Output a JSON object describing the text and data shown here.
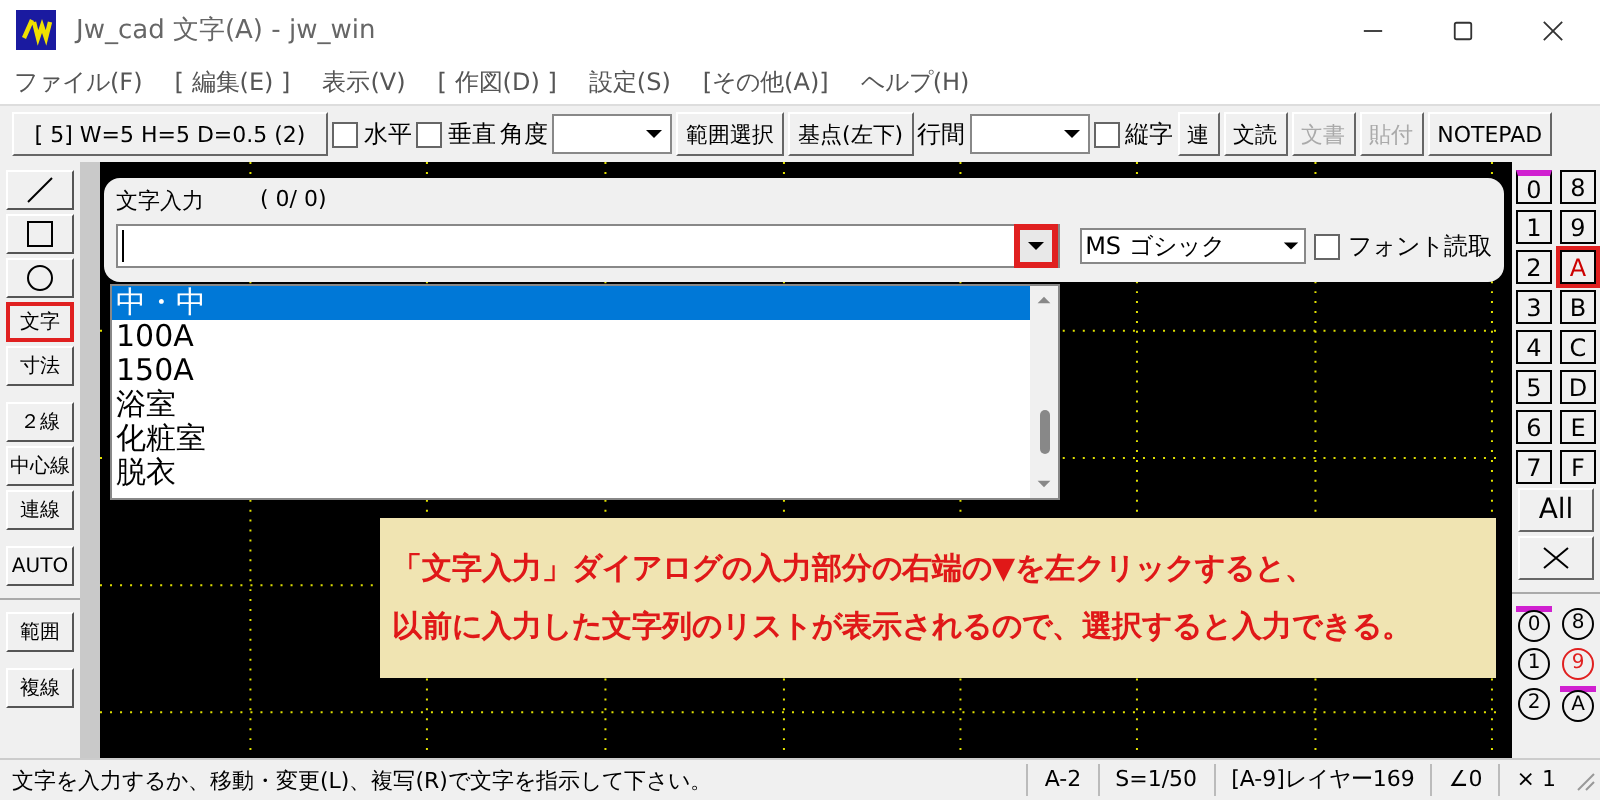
{
  "window": {
    "title": "Jw_cad 文字(A) - jw_win"
  },
  "menu": [
    "ファイル(F)",
    "[ 編集(E) ]",
    "表示(V)",
    "[ 作図(D) ]",
    "設定(S)",
    "[その他(A)]",
    "ヘルプ(H)"
  ],
  "toolbar": [
    {
      "kind": "button",
      "label": "[ 5]  W=5  H=5  D=0.5 (2)",
      "disabled": false
    },
    {
      "kind": "checkbox",
      "label": "水平",
      "checked": false
    },
    {
      "kind": "checkbox",
      "label": "垂直",
      "checked": false
    },
    {
      "kind": "label",
      "label": "角度"
    },
    {
      "kind": "combo"
    },
    {
      "kind": "button",
      "label": "範囲選択",
      "disabled": false
    },
    {
      "kind": "button",
      "label": "基点(左下)",
      "disabled": false
    },
    {
      "kind": "label",
      "label": "行間"
    },
    {
      "kind": "combo"
    },
    {
      "kind": "checkbox",
      "label": "縦字",
      "checked": false
    },
    {
      "kind": "button",
      "label": "連",
      "disabled": false
    },
    {
      "kind": "button",
      "label": "文読",
      "disabled": false
    },
    {
      "kind": "button",
      "label": "文書",
      "disabled": true
    },
    {
      "kind": "button",
      "label": "貼付",
      "disabled": true
    },
    {
      "kind": "button",
      "label": "NOTEPAD",
      "disabled": false
    }
  ],
  "tools": [
    {
      "kind": "line",
      "highlighted": false
    },
    {
      "kind": "rect",
      "highlighted": false
    },
    {
      "kind": "circle",
      "highlighted": false
    },
    {
      "kind": "text",
      "label": "文字",
      "highlighted": true
    },
    {
      "kind": "text",
      "label": "寸法",
      "highlighted": false
    },
    {
      "kind": "gap"
    },
    {
      "kind": "text",
      "label": "２線",
      "highlighted": false
    },
    {
      "kind": "text",
      "label": "中心線",
      "highlighted": false
    },
    {
      "kind": "text",
      "label": "連線",
      "highlighted": false
    },
    {
      "kind": "gap"
    },
    {
      "kind": "text",
      "label": "AUTO",
      "highlighted": false
    },
    {
      "kind": "rule"
    },
    {
      "kind": "text",
      "label": "範囲",
      "highlighted": false
    },
    {
      "kind": "gap"
    },
    {
      "kind": "text",
      "label": "複線",
      "highlighted": false
    }
  ],
  "text_input": {
    "label": "文字入力",
    "count": "(  0/   0)",
    "dropdown_highlighted": true,
    "font": "MS ゴシック",
    "font_read": {
      "label": "フォント読取",
      "checked": false
    },
    "history": [
      {
        "text": "中・中",
        "selected": true
      },
      {
        "text": "100A",
        "selected": false
      },
      {
        "text": "150A",
        "selected": false
      },
      {
        "text": "浴室",
        "selected": false
      },
      {
        "text": "化粧室",
        "selected": false
      },
      {
        "text": "脱衣",
        "selected": false
      }
    ]
  },
  "callout": {
    "lines": [
      "「文字入力」ダイアログの入力部分の右端の▼を左クリックすると、",
      "以前に入力した文字列のリストが表示されるので、選択すると入力できる。"
    ]
  },
  "layer_groups": [
    {
      "label": "0",
      "selected": false,
      "marked": true
    },
    {
      "label": "8",
      "selected": false,
      "marked": false
    },
    {
      "label": "1",
      "selected": false,
      "marked": false
    },
    {
      "label": "9",
      "selected": false,
      "marked": false
    },
    {
      "label": "2",
      "selected": false,
      "marked": false
    },
    {
      "label": "A",
      "selected": true,
      "marked": false
    },
    {
      "label": "3",
      "selected": false,
      "marked": false
    },
    {
      "label": "B",
      "selected": false,
      "marked": false
    },
    {
      "label": "4",
      "selected": false,
      "marked": false
    },
    {
      "label": "C",
      "selected": false,
      "marked": false
    },
    {
      "label": "5",
      "selected": false,
      "marked": false
    },
    {
      "label": "D",
      "selected": false,
      "marked": false
    },
    {
      "label": "6",
      "selected": false,
      "marked": false
    },
    {
      "label": "E",
      "selected": false,
      "marked": false
    },
    {
      "label": "7",
      "selected": false,
      "marked": false
    },
    {
      "label": "F",
      "selected": false,
      "marked": false
    }
  ],
  "all_button": "All",
  "layers": [
    {
      "label": "0",
      "selected": false,
      "marked": true
    },
    {
      "label": "8",
      "selected": false,
      "marked": false
    },
    {
      "label": "1",
      "selected": false,
      "marked": false
    },
    {
      "label": "9",
      "selected": true,
      "marked": false
    },
    {
      "label": "2",
      "selected": false,
      "marked": false
    },
    {
      "label": "A",
      "selected": false,
      "marked": true
    }
  ],
  "status_bar": {
    "message": "文字を入力するか、移動・変更(L)、複写(R)で文字を指示して下さい。",
    "fields": [
      "A-2",
      "S=1/50",
      "[A-9]レイヤー169",
      "∠0",
      "× 1"
    ]
  }
}
